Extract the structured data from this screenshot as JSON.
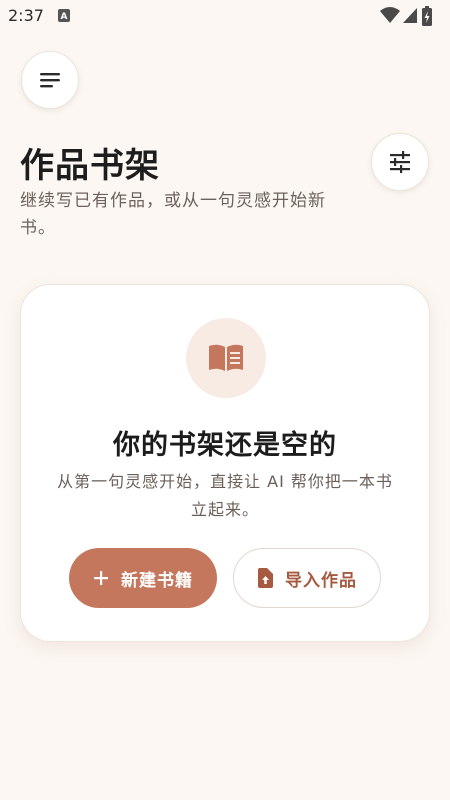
{
  "status_bar": {
    "time": "2:37",
    "app_icon": "a-notification-icon",
    "icons": [
      "wifi-icon",
      "signal-icon",
      "battery-charging-icon"
    ]
  },
  "header": {
    "menu_icon": "menu-icon",
    "filter_icon": "tune-icon",
    "title": "作品书架",
    "subtitle": "继续写已有作品，或从一句灵感开始新书。"
  },
  "empty_state": {
    "icon": "open-book-icon",
    "title": "你的书架还是空的",
    "description": "从第一句灵感开始，直接让 AI 帮你把一本书立起来。",
    "new_book_label": "新建书籍",
    "new_book_icon": "plus-icon",
    "import_label": "导入作品",
    "import_icon": "file-upload-icon"
  },
  "colors": {
    "background": "#fcf7f2",
    "accent": "#c4775c",
    "accent_text": "#a65a40"
  }
}
